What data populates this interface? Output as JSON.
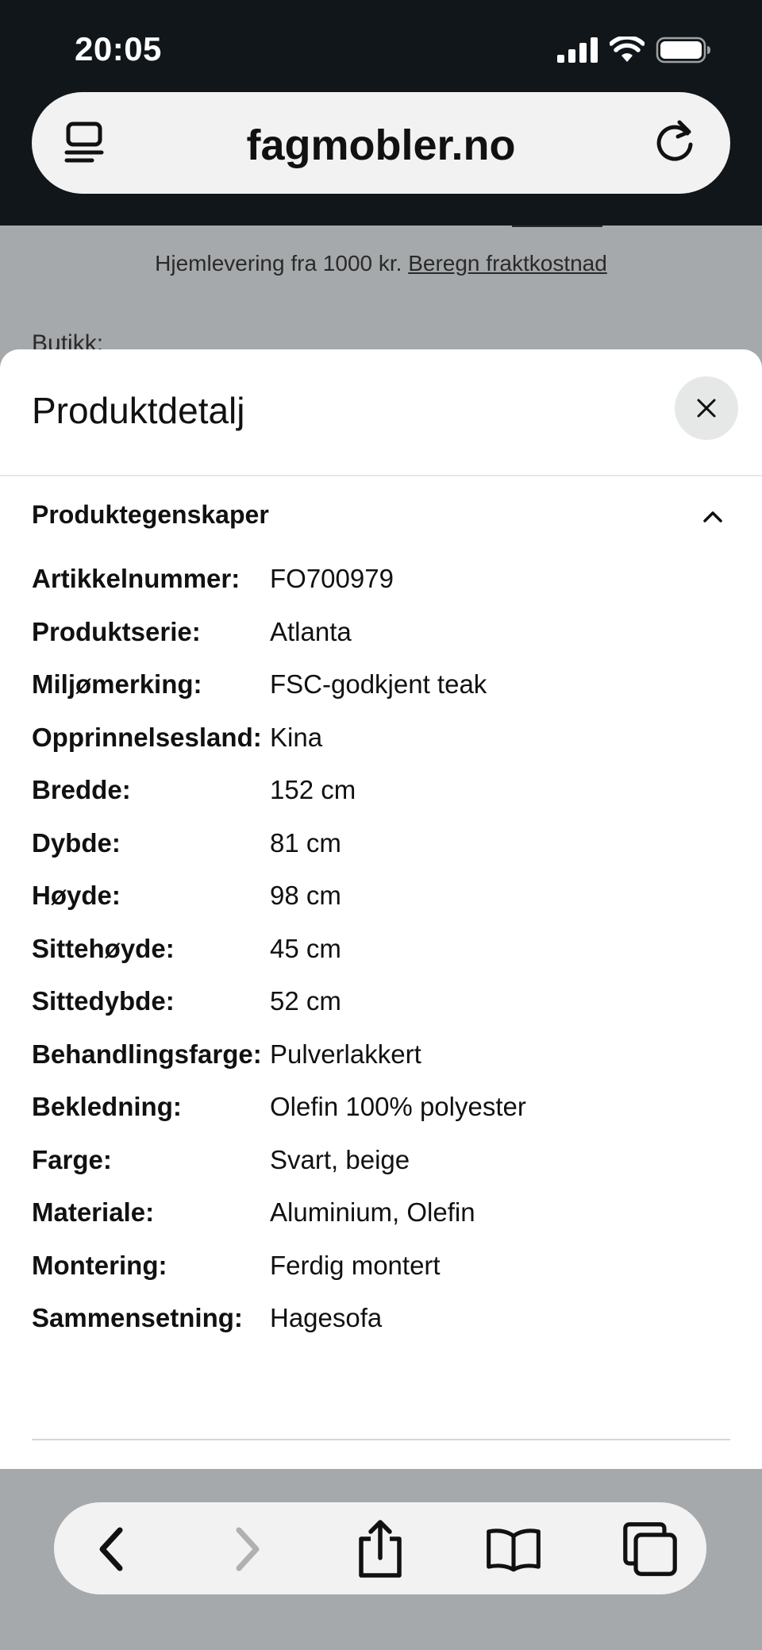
{
  "status_bar": {
    "time": "20:05"
  },
  "browser": {
    "url": "fagmobler.no"
  },
  "page": {
    "delivery_text": "Hjemlevering fra 1000 kr.",
    "delivery_link": "Beregn fraktkostnad",
    "store_label": "Butikk:"
  },
  "sheet": {
    "title": "Produktdetalj",
    "section_title": "Produktegenskaper",
    "properties": [
      {
        "label": "Artikkelnummer:",
        "value": "FO700979"
      },
      {
        "label": "Produktserie:",
        "value": "Atlanta"
      },
      {
        "label": "Miljømerking:",
        "value": "FSC-godkjent teak"
      },
      {
        "label": "Opprinnelsesland:",
        "value": "Kina"
      },
      {
        "label": "Bredde:",
        "value": "152 cm"
      },
      {
        "label": "Dybde:",
        "value": "81 cm"
      },
      {
        "label": "Høyde:",
        "value": "98 cm"
      },
      {
        "label": "Sittehøyde:",
        "value": "45 cm"
      },
      {
        "label": "Sittedybde:",
        "value": "52 cm"
      },
      {
        "label": "Behandlingsfarge:",
        "value": "Pulverlakkert"
      },
      {
        "label": "Bekledning:",
        "value": "Olefin 100% polyester"
      },
      {
        "label": "Farge:",
        "value": "Svart, beige"
      },
      {
        "label": "Materiale:",
        "value": "Aluminium, Olefin"
      },
      {
        "label": "Montering:",
        "value": "Ferdig montert"
      },
      {
        "label": "Sammensetning:",
        "value": "Hagesofa"
      }
    ]
  },
  "icons": {
    "status": [
      "signal-icon",
      "wifi-icon",
      "battery-icon"
    ],
    "browser": [
      "reader-mode-icon",
      "reload-icon"
    ],
    "sheet": [
      "close-icon",
      "chevron-up-icon"
    ],
    "toolbar": [
      "back-icon",
      "forward-icon",
      "share-icon",
      "bookmarks-icon",
      "tabs-icon"
    ]
  },
  "colors": {
    "chrome_dark": "#101619",
    "overlay_gray": "#a6a9ab",
    "sheet_bg": "#ffffff",
    "close_btn_bg": "#e6e8e8",
    "forward_disabled": "#b0b0b0"
  }
}
